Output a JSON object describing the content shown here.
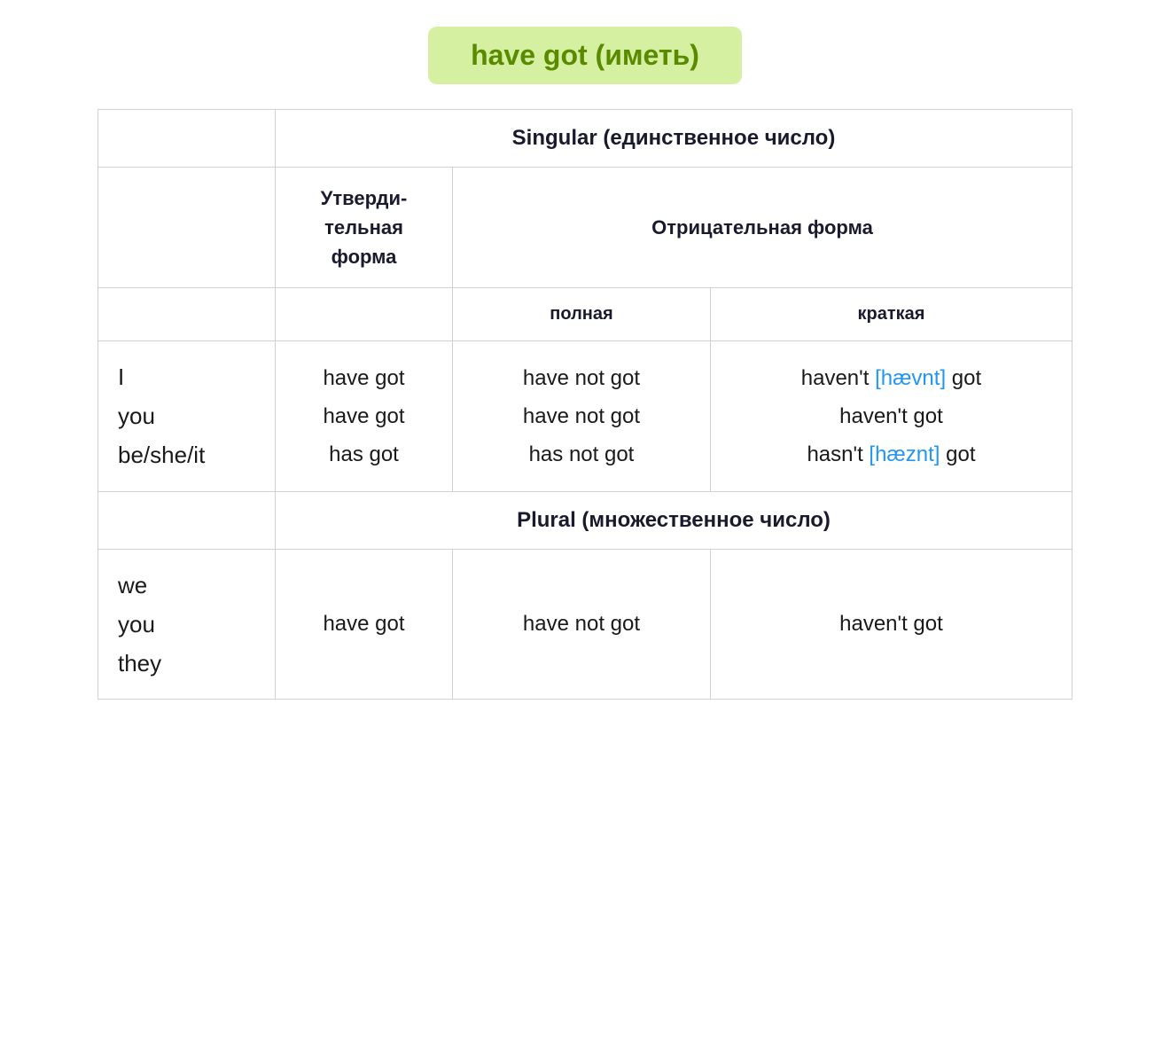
{
  "title": "have got (иметь)",
  "table": {
    "singular_label": "Singular (единственное число)",
    "plural_label": "Plural (множественное число)",
    "affirm_header": "Утверди-тельная форма",
    "neg_header": "Отрицательная форма",
    "full_sub": "полная",
    "short_sub": "краткая",
    "singular_pronouns": "I\nyou\nbe/she/it",
    "singular_affirm": "have got\nhave got\nhas got",
    "singular_neg_full": "have not got\nhave not got\nhas not got",
    "singular_neg_short_pre1": "haven't",
    "singular_neg_short_phonetic1": "[hævnt]",
    "singular_neg_short_post1": "got",
    "singular_neg_short_line2": "haven't got",
    "singular_neg_short_pre3": "hasn't",
    "singular_neg_short_phonetic3": "[hæznt]",
    "singular_neg_short_post3": "got",
    "plural_pronouns": "we\nyou\nthey",
    "plural_affirm": "have got",
    "plural_neg_full": "have not got",
    "plural_neg_short": "haven't got"
  }
}
